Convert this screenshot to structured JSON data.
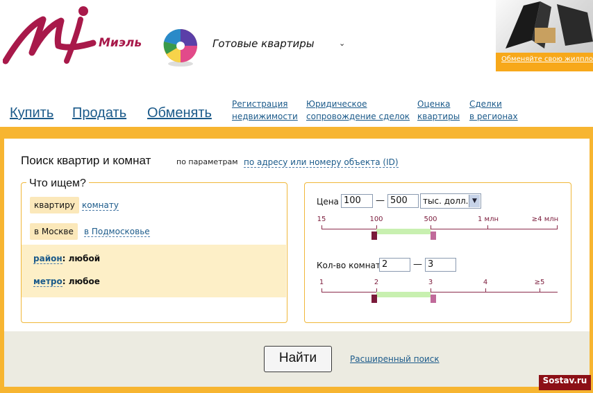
{
  "header": {
    "brand": "Миэль",
    "product_title": "Готовые квартиры",
    "promo_link": "Обменяйте свою жилплощадь"
  },
  "main_nav": [
    {
      "label": "Купить"
    },
    {
      "label": "Продать"
    },
    {
      "label": "Обменять"
    }
  ],
  "secondary_nav": [
    {
      "line1": "Регистрация",
      "line2": "недвижимости"
    },
    {
      "line1": "Юридическое",
      "line2": "сопровождение сделок"
    },
    {
      "line1": "Оценка",
      "line2": "квартиры"
    },
    {
      "line1": "Сделки",
      "line2": "в регионах"
    }
  ],
  "search": {
    "title": "Поиск квартир и комнат",
    "by_params": "по параметрам",
    "by_address": "по адресу или номеру объекта (ID)",
    "what_label": "Что ищем?",
    "type_selected": "квартиру",
    "type_other": "комнату",
    "location_selected": "в Москве",
    "location_other": "в Подмосковье",
    "district_key": "район",
    "district_value": ": любой",
    "metro_key": "метро",
    "metro_value": ": любое",
    "price_label": "Цена",
    "price_from": "100",
    "price_to": "500",
    "price_dash": "—",
    "price_unit": "тыс. долл.",
    "price_scale": [
      "15",
      "100",
      "500",
      "1 млн",
      "≥4 млн"
    ],
    "rooms_label": "Кол-во комнат",
    "rooms_from": "2",
    "rooms_to": "3",
    "rooms_dash": "—",
    "rooms_scale": [
      "1",
      "2",
      "3",
      "4",
      "≥5"
    ],
    "find_button": "Найти",
    "advanced": "Расширенный поиск"
  },
  "watermark": "Sostav.ru",
  "colors": {
    "accent_orange": "#f7b531",
    "link_blue": "#1b5a8a",
    "brand_magenta": "#a8194a"
  }
}
